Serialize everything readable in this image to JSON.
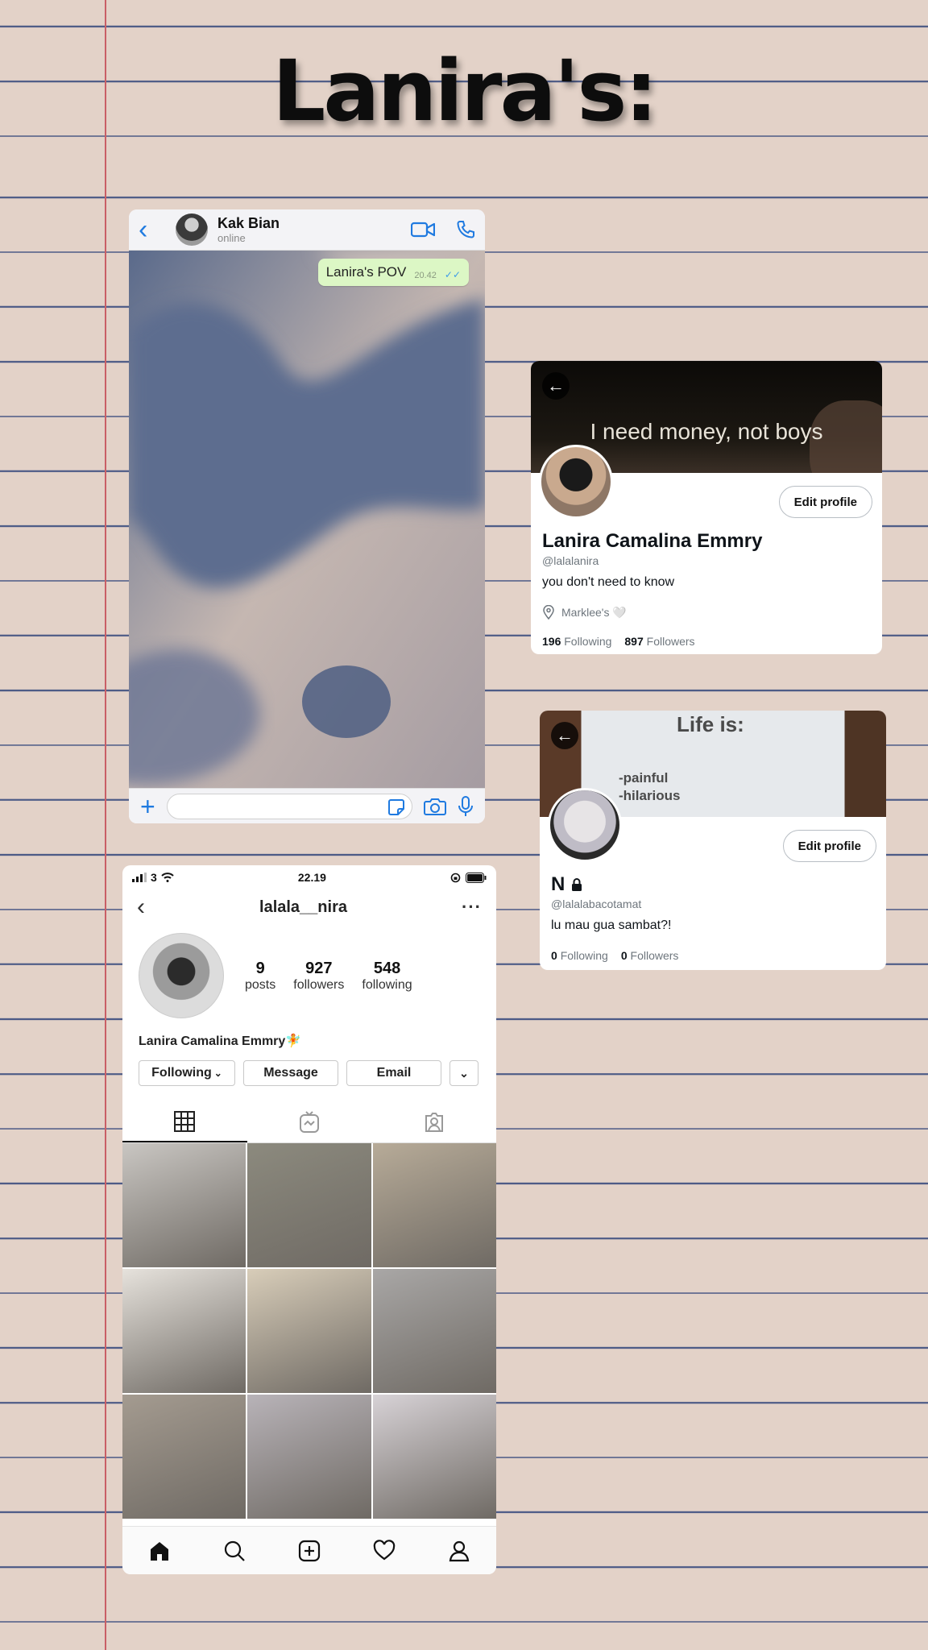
{
  "page": {
    "title": "Lanira's:"
  },
  "chat": {
    "contact_name": "Kak Bian",
    "contact_status": "online",
    "message": {
      "text": "Lanira's POV",
      "time": "20.42",
      "ticks": "✓✓"
    },
    "input_placeholder": ""
  },
  "twitter_main": {
    "banner_text": "I need money, not boys",
    "edit_button": "Edit profile",
    "name": "Lanira Camalina Emmry",
    "handle": "@lalalanira",
    "bio": "you don't need to know",
    "location": "Marklee's 🤍",
    "following_count": "196",
    "following_label": "Following",
    "followers_count": "897",
    "followers_label": "Followers"
  },
  "twitter_alt": {
    "banner_title": "Life is:",
    "banner_line1": "-painful",
    "banner_line2": "-hilarious",
    "edit_button": "Edit profile",
    "name": "N",
    "handle": "@lalalabacotamat",
    "bio": "lu mau gua sambat?!",
    "following_count": "0",
    "following_label": "Following",
    "followers_count": "0",
    "followers_label": "Followers"
  },
  "instagram": {
    "status_carrier": "3",
    "status_time": "22.19",
    "username": "lalala__nira",
    "posts_count": "9",
    "posts_label": "posts",
    "followers_count": "927",
    "followers_label": "followers",
    "following_count": "548",
    "following_label": "following",
    "full_name": "Lanira Camalina Emmry🧚",
    "following_button": "Following",
    "message_button": "Message",
    "email_button": "Email",
    "grid_colors": [
      "#c9c6c2",
      "#8c8a7e",
      "#b7ab98",
      "#e6e2dc",
      "#d8cdb9",
      "#a9a7a6",
      "#a49b90",
      "#b8b3b8",
      "#d7d2d6"
    ]
  },
  "colors": {
    "whatsapp_blue": "#1f7ae0",
    "bubble_green": "#dcf7c5",
    "margin_red": "#c95f66",
    "line_blue": "#4c5a86"
  }
}
